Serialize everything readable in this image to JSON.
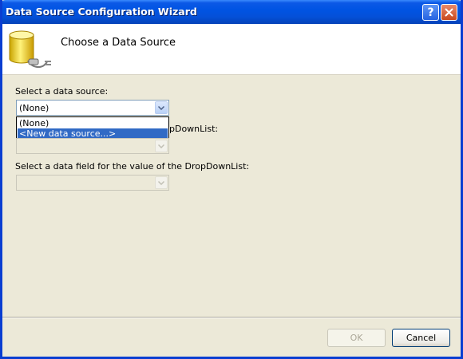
{
  "window": {
    "title": "Data Source Configuration Wizard",
    "help_label": "?",
    "close_icon": "close-icon"
  },
  "header": {
    "title": "Choose a Data Source",
    "icon": "database-plug-icon"
  },
  "form": {
    "data_source": {
      "label": "Select a data source:",
      "value": "(None)",
      "options": [
        "(None)",
        "<New data source...>"
      ],
      "selected_index": 1
    },
    "display_field": {
      "label_visible_fragment": "pDownList:",
      "value": ""
    },
    "value_field": {
      "label": "Select a data field for the value of the DropDownList:",
      "value": ""
    }
  },
  "buttons": {
    "ok": "OK",
    "cancel": "Cancel"
  },
  "colors": {
    "titlebar": "#0054e3",
    "dialog_bg": "#ece9d8",
    "selection": "#316ac5"
  }
}
